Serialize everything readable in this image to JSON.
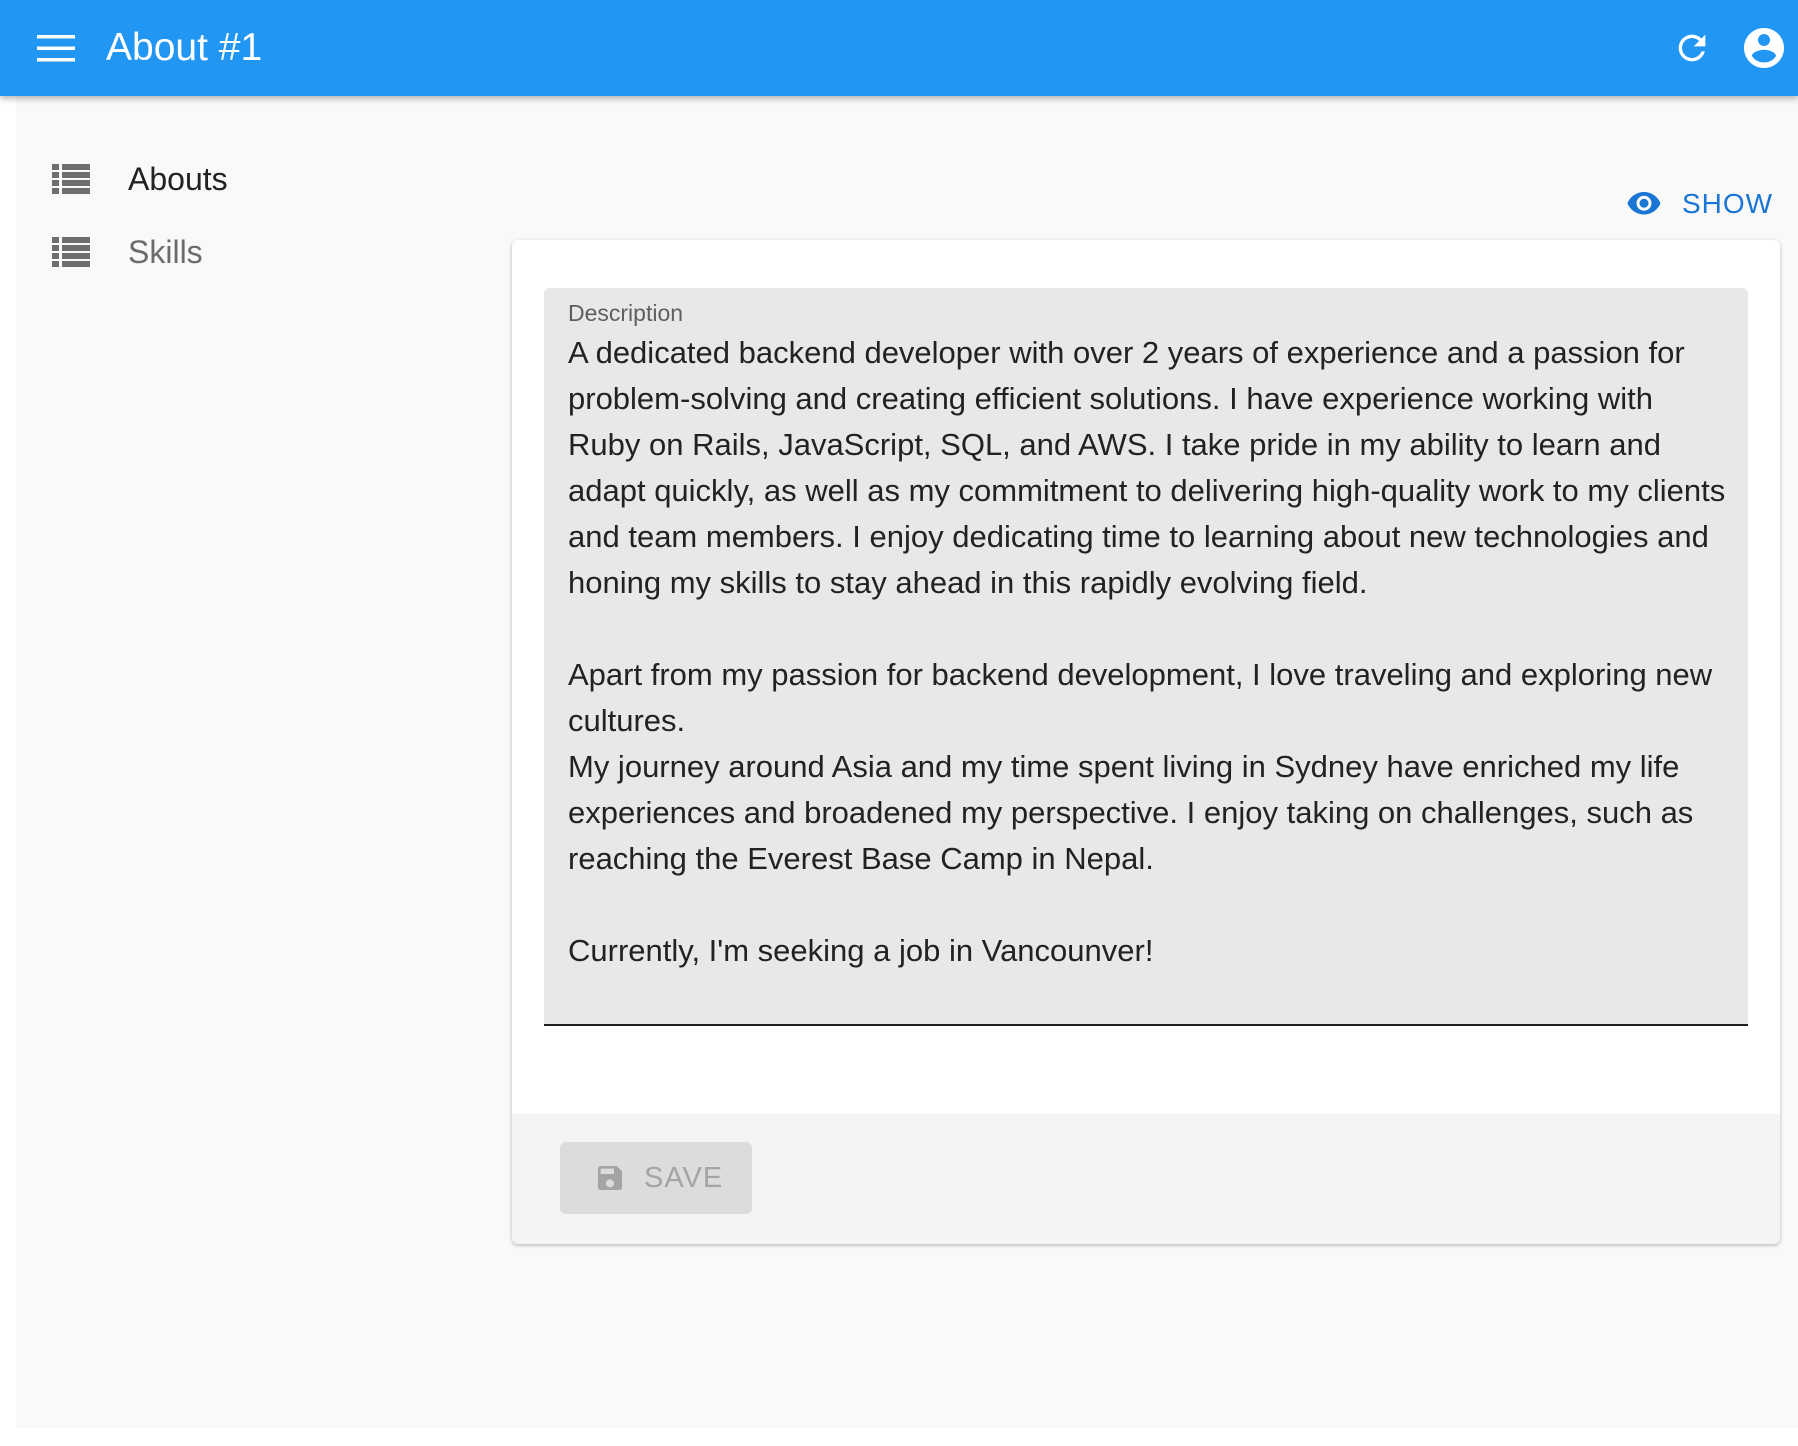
{
  "app_bar": {
    "title": "About #1",
    "background_color": "#2196f3",
    "menu_icon": "menu-icon",
    "refresh_icon": "refresh-icon",
    "account_icon": "account-circle-icon"
  },
  "sidebar": {
    "items": [
      {
        "label": "Abouts",
        "icon": "list-icon",
        "active": true
      },
      {
        "label": "Skills",
        "icon": "list-icon",
        "active": false
      }
    ]
  },
  "actions": {
    "show_label": "SHOW",
    "show_icon": "eye-icon",
    "accent_color": "#1976d2"
  },
  "form": {
    "description_label": "Description",
    "description_value": "A dedicated backend developer with over 2 years of experience and a passion for problem-solving and creating efficient solutions. I have experience working with Ruby on Rails, JavaScript, SQL, and AWS. I take pride in my ability to learn and adapt quickly, as well as my commitment to delivering high-quality work to my clients and team members. I enjoy dedicating time to learning about new technologies and honing my skills to stay ahead in this rapidly evolving field.\n\nApart from my passion for backend development, I love traveling and exploring new cultures.\nMy journey around Asia and my time spent living in Sydney have enriched my life experiences and broadened my perspective. I enjoy taking on challenges, such as reaching the Everest Base Camp in Nepal.\n\nCurrently, I'm seeking a job in Vancounver!"
  },
  "toolbar": {
    "save_label": "SAVE",
    "save_icon": "save-icon",
    "save_disabled": true
  }
}
